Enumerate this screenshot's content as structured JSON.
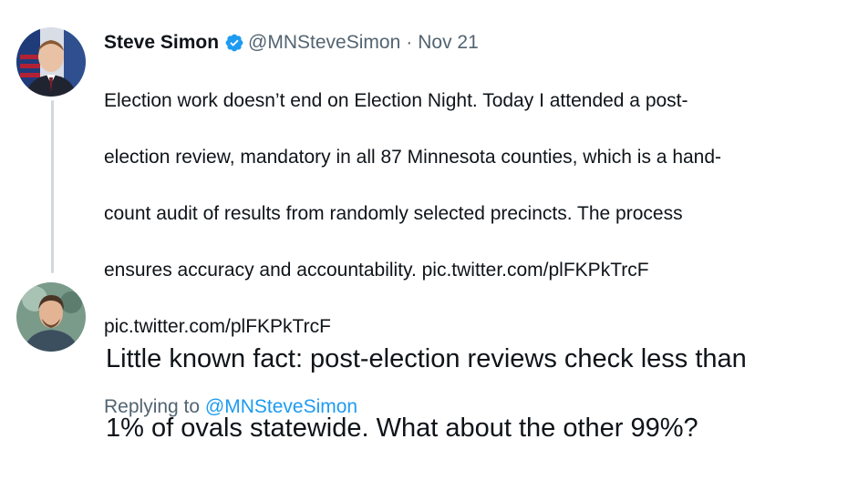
{
  "original_tweet": {
    "author_name": "Steve Simon",
    "handle": "@MNSteveSimon",
    "separator": "·",
    "date": "Nov 21",
    "body_lines": [
      "Election work doesn’t end on Election Night. Today I attended a post-",
      "election review, mandatory in all 87 Minnesota counties, which is a hand-",
      "count audit of results from randomly selected precincts. The process",
      "ensures accuracy and accountability. pic.twitter.com/plFKPkTrcF",
      "pic.twitter.com/plFKPkTrcF"
    ],
    "replying_to_prefix": "Replying to ",
    "replying_to_handle": "@MNSteveSimon",
    "verified_icon": "verified-badge-icon"
  },
  "reply": {
    "body_lines": [
      "Little known fact: post-election reviews check less than",
      "1% of ovals statewide. What about the other 99%?"
    ]
  },
  "colors": {
    "text_primary": "#0f1419",
    "text_secondary": "#536471",
    "link": "#1d9bf0",
    "thread_line": "#cfd9de",
    "verified": "#1d9bf0"
  }
}
